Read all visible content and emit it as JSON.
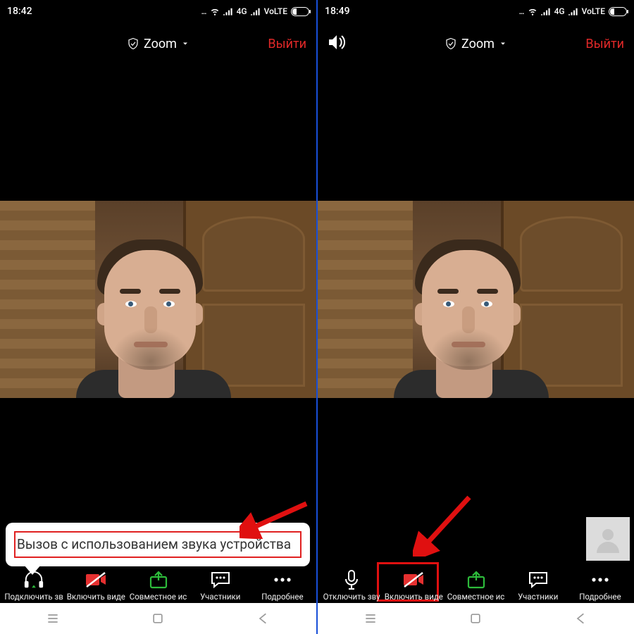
{
  "left": {
    "status": {
      "time": "18:42",
      "dots": "...",
      "net": "4G",
      "volte": "VoLTE"
    },
    "header": {
      "title": "Zoom",
      "leave": "Выйти"
    },
    "popup": {
      "text": "Вызов с использованием звука устройства"
    },
    "toolbar": [
      {
        "key": "audio",
        "label": "Подключить зв"
      },
      {
        "key": "video",
        "label": "Включить виде"
      },
      {
        "key": "share",
        "label": "Совместное ис"
      },
      {
        "key": "part",
        "label": "Участники"
      },
      {
        "key": "more",
        "label": "Подробнее"
      }
    ]
  },
  "right": {
    "status": {
      "time": "18:49",
      "dots": "...",
      "net": "4G",
      "volte": "VoLTE"
    },
    "header": {
      "title": "Zoom",
      "leave": "Выйти"
    },
    "toolbar": [
      {
        "key": "audio",
        "label": "Отключить зву"
      },
      {
        "key": "video",
        "label": "Включить виде"
      },
      {
        "key": "share",
        "label": "Совместное ис"
      },
      {
        "key": "part",
        "label": "Участники"
      },
      {
        "key": "more",
        "label": "Подробнее"
      }
    ]
  },
  "colors": {
    "accent": "#e02828",
    "green": "#2dbb3b",
    "videoOff": "#e53030"
  }
}
